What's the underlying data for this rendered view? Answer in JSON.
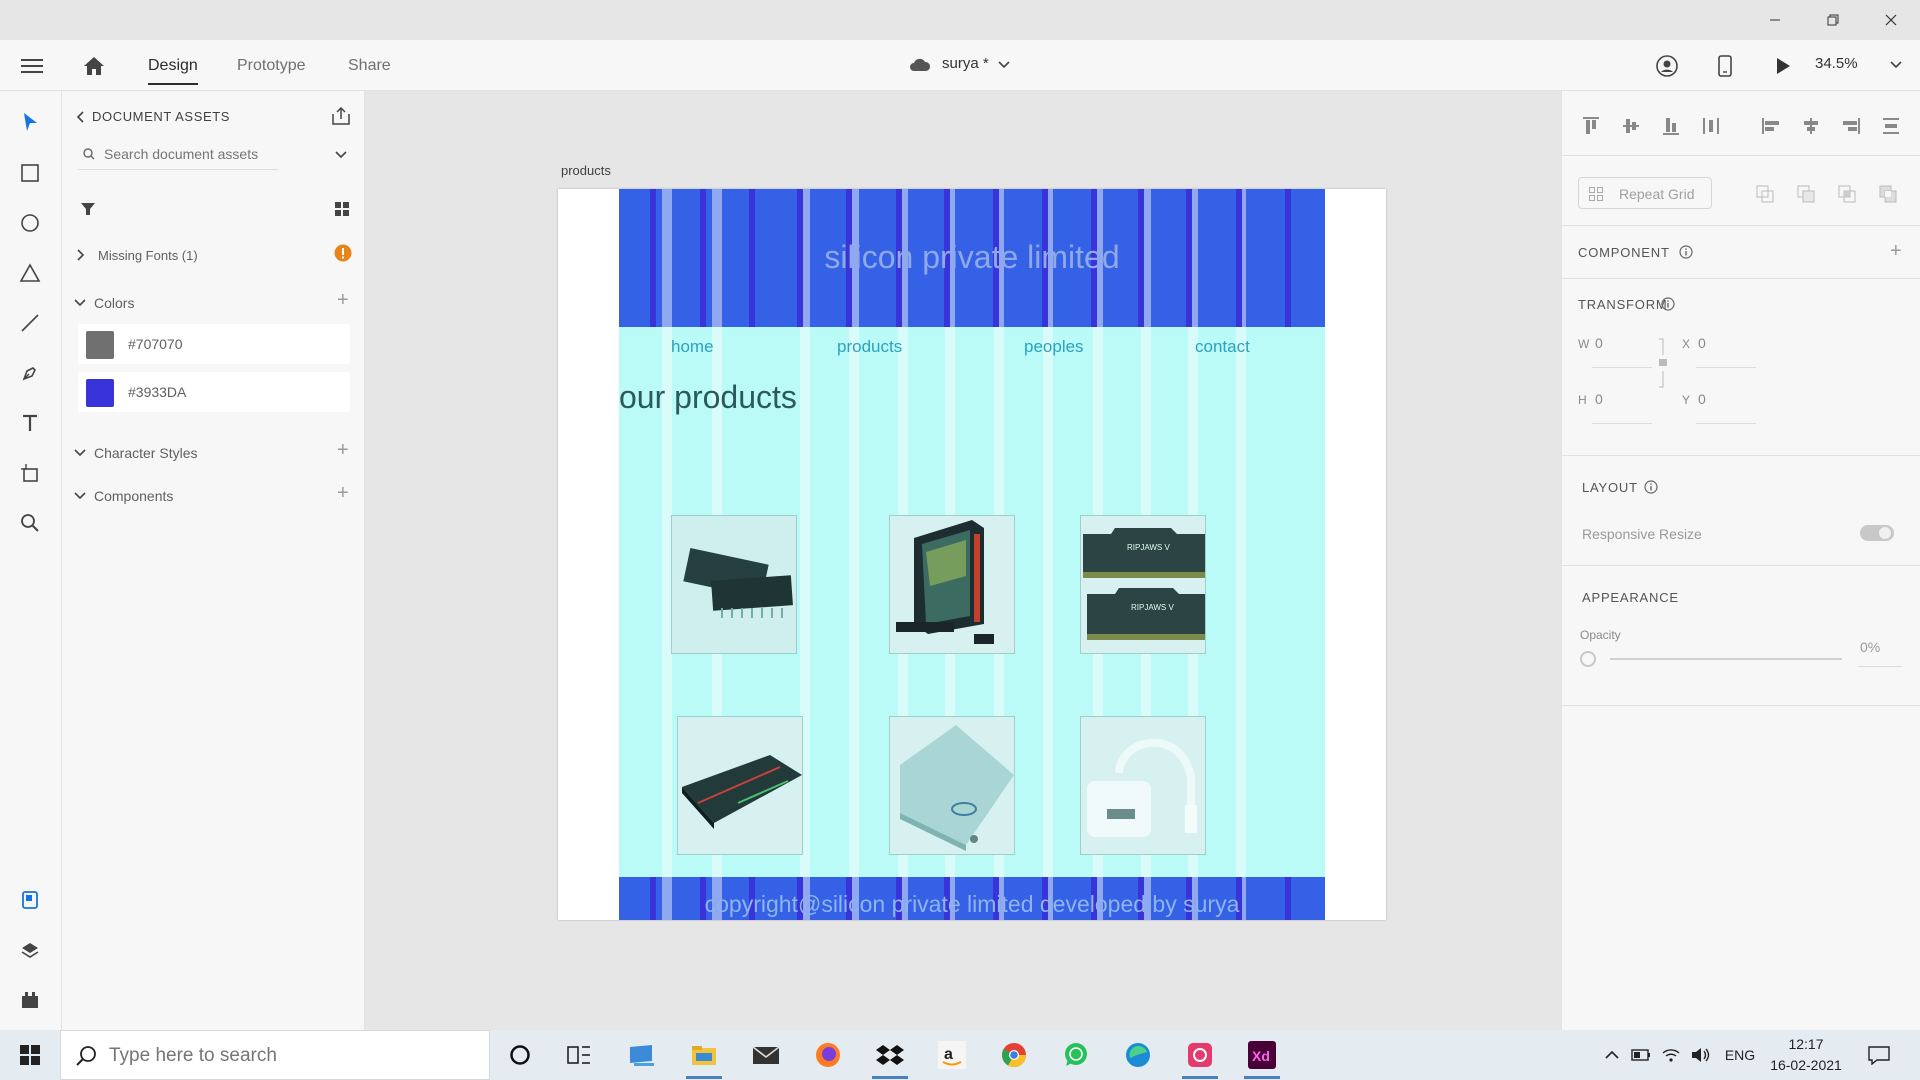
{
  "topbar": {
    "tabs": [
      "Design",
      "Prototype",
      "Share"
    ],
    "doc_name": "surya *",
    "zoom": "34.5%"
  },
  "assets_panel": {
    "title": "DOCUMENT ASSETS",
    "search_placeholder": "Search document assets",
    "missing_fonts": "Missing Fonts (1)",
    "colors_label": "Colors",
    "colors": [
      {
        "hex": "#707070",
        "label": "#707070"
      },
      {
        "hex": "#3933DA",
        "label": "#3933DA"
      }
    ],
    "character_styles_label": "Character Styles",
    "components_label": "Components"
  },
  "artboard": {
    "label": "products",
    "site_title": "silicon private limited",
    "nav": [
      "home",
      "products",
      "peoples",
      "contact"
    ],
    "heading": "our products",
    "footer": "copyright@silicon private limited developed by surya",
    "products": [
      "ic-chip",
      "gaming-pc",
      "ram-modules",
      "keyboard",
      "ssd-drive",
      "hdmi-adapter"
    ]
  },
  "properties": {
    "repeat_grid": "Repeat Grid",
    "component": "COMPONENT",
    "transform": "TRANSFORM",
    "w_label": "W",
    "w_value": "0",
    "x_label": "X",
    "x_value": "0",
    "h_label": "H",
    "h_value": "0",
    "y_label": "Y",
    "y_value": "0",
    "layout": "LAYOUT",
    "responsive_resize": "Responsive Resize",
    "appearance": "APPEARANCE",
    "opacity_label": "Opacity",
    "opacity_value": "0%"
  },
  "taskbar": {
    "search_placeholder": "Type here to search",
    "lang": "ENG",
    "time": "12:17",
    "date": "16-02-2021"
  },
  "colors": {
    "header_blue": "#3461e6",
    "swatch_gray": "#707070",
    "swatch_blue": "#3933DA",
    "content_cyan": "#bafaf7"
  }
}
